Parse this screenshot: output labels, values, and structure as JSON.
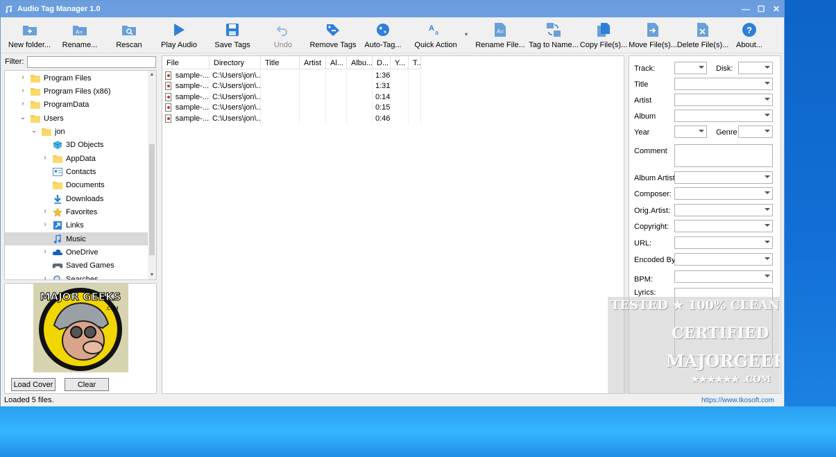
{
  "window": {
    "title": "Audio Tag Manager 1.0",
    "controls": [
      "—",
      "☐",
      "✕"
    ]
  },
  "toolbar": {
    "buttons": [
      {
        "label": "New folder...",
        "icon": "new-folder-icon",
        "enabled": true
      },
      {
        "label": "Rename...",
        "icon": "rename-icon",
        "enabled": true
      },
      {
        "label": "Rescan",
        "icon": "rescan-icon",
        "enabled": true
      },
      {
        "label": "Play Audio",
        "icon": "play-icon",
        "enabled": true
      },
      {
        "label": "Save Tags",
        "icon": "save-icon",
        "enabled": true
      },
      {
        "label": "Undo",
        "icon": "undo-icon",
        "enabled": false
      },
      {
        "label": "Remove Tags",
        "icon": "tag-remove-icon",
        "enabled": true
      },
      {
        "label": "Auto-Tag...",
        "icon": "globe-icon",
        "enabled": true
      },
      {
        "label": "Quick Action",
        "icon": "text-format-icon",
        "enabled": true
      },
      {
        "label": "Rename File...",
        "icon": "rename-file-icon",
        "enabled": true
      },
      {
        "label": "Tag to Name...",
        "icon": "tag-to-name-icon",
        "enabled": true
      },
      {
        "label": "Copy File(s)...",
        "icon": "copy-icon",
        "enabled": true
      },
      {
        "label": "Move File(s)...",
        "icon": "move-icon",
        "enabled": true
      },
      {
        "label": "Delete File(s)...",
        "icon": "delete-icon",
        "enabled": true
      },
      {
        "label": "About...",
        "icon": "help-icon",
        "enabled": true
      }
    ]
  },
  "filter": {
    "label": "Filter:",
    "value": ""
  },
  "tree": {
    "items": [
      {
        "label": "Program Files",
        "level": 1,
        "expander": "›",
        "icon": "folder-icon"
      },
      {
        "label": "Program Files (x86)",
        "level": 1,
        "expander": "›",
        "icon": "folder-icon"
      },
      {
        "label": "ProgramData",
        "level": 1,
        "expander": "›",
        "icon": "folder-icon"
      },
      {
        "label": "Users",
        "level": 1,
        "expander": "⌄",
        "icon": "folder-icon"
      },
      {
        "label": "jon",
        "level": 2,
        "expander": "⌄",
        "icon": "folder-icon"
      },
      {
        "label": "3D Objects",
        "level": 3,
        "expander": "",
        "icon": "cube-icon"
      },
      {
        "label": "AppData",
        "level": 3,
        "expander": "›",
        "icon": "folder-icon"
      },
      {
        "label": "Contacts",
        "level": 3,
        "expander": "",
        "icon": "contacts-icon"
      },
      {
        "label": "Documents",
        "level": 3,
        "expander": "",
        "icon": "folder-icon"
      },
      {
        "label": "Downloads",
        "level": 3,
        "expander": "",
        "icon": "download-icon"
      },
      {
        "label": "Favorites",
        "level": 3,
        "expander": "›",
        "icon": "star-icon"
      },
      {
        "label": "Links",
        "level": 3,
        "expander": "›",
        "icon": "link-icon"
      },
      {
        "label": "Music",
        "level": 3,
        "expander": "",
        "icon": "music-icon",
        "selected": true
      },
      {
        "label": "OneDrive",
        "level": 3,
        "expander": "›",
        "icon": "cloud-icon"
      },
      {
        "label": "Saved Games",
        "level": 3,
        "expander": "",
        "icon": "games-icon"
      },
      {
        "label": "Searches",
        "level": 3,
        "expander": "›",
        "icon": "search-icon"
      }
    ]
  },
  "cover": {
    "logo_text": "MAJOR GEEKS",
    "logo_sub": ".COM",
    "load_label": "Load Cover",
    "clear_label": "Clear"
  },
  "files": {
    "columns": [
      "File",
      "Directory",
      "Title",
      "Artist",
      "Al...",
      "Albu...",
      "D...",
      "Y...",
      "T..."
    ],
    "rows": [
      {
        "file": "sample-...",
        "dir": "C:\\Users\\jon\\...",
        "duration": "1:36"
      },
      {
        "file": "sample-...",
        "dir": "C:\\Users\\jon\\...",
        "duration": "1:31"
      },
      {
        "file": "sample-...",
        "dir": "C:\\Users\\jon\\...",
        "duration": "0:14"
      },
      {
        "file": "sample-...",
        "dir": "C:\\Users\\jon\\...",
        "duration": "0:15"
      },
      {
        "file": "sample-...",
        "dir": "C:\\Users\\jon\\...",
        "duration": "0:46"
      }
    ]
  },
  "tags": {
    "track": "Track:",
    "disk": "Disk:",
    "title": "Title",
    "artist": "Artist",
    "album": "Album",
    "year": "Year",
    "genre": "Genre",
    "comment": "Comment",
    "album_artist": "Album Artist:",
    "composer": "Composer:",
    "orig_artist": "Orig.Artist:",
    "copyright": "Copyright:",
    "url": "URL:",
    "encoded_by": "Encoded By:",
    "bpm": "BPM:",
    "lyrics": "Lyrics:"
  },
  "watermark": {
    "line1": "TESTED ★ 100% CLEAN",
    "line2": "CERTIFIED",
    "line3": "MAJORGEEKS",
    "line4": "★★★★★★ .COM"
  },
  "status": {
    "text": "Loaded 5 files.",
    "url": "https://www.tkosoft.com"
  }
}
